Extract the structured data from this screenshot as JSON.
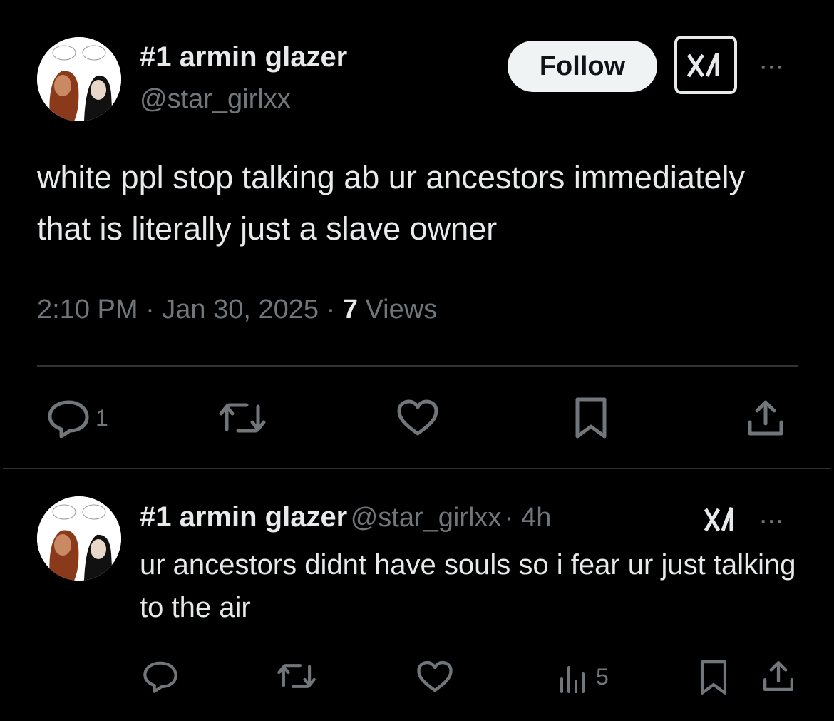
{
  "tweet": {
    "author_name": "#1 armin glazer",
    "author_handle": "@star_girlxx",
    "follow_label": "Follow",
    "more_label": "···",
    "text": "white ppl stop talking ab ur ancestors immediately that is literally just a slave owner",
    "timestamp": "2:10 PM · Jan 30, 2025 ·",
    "views_count": "7",
    "views_label": "Views",
    "reply_count": "1"
  },
  "reply": {
    "author_name": "#1 armin glazer",
    "author_handle": "@star_girlxx",
    "age": "· 4h",
    "more_label": "···",
    "text": "ur ancestors didnt have souls so i fear ur just talking to the air",
    "views_count": "5"
  },
  "colors": {
    "background": "#000000",
    "text": "#e7e9ea",
    "secondary": "#71767b",
    "divider": "#2f3336",
    "follow_bg": "#eff3f4"
  },
  "icons": [
    "reply-icon",
    "retweet-icon",
    "like-icon",
    "bookmark-icon",
    "share-icon",
    "grok-icon",
    "analytics-icon",
    "more-icon"
  ]
}
